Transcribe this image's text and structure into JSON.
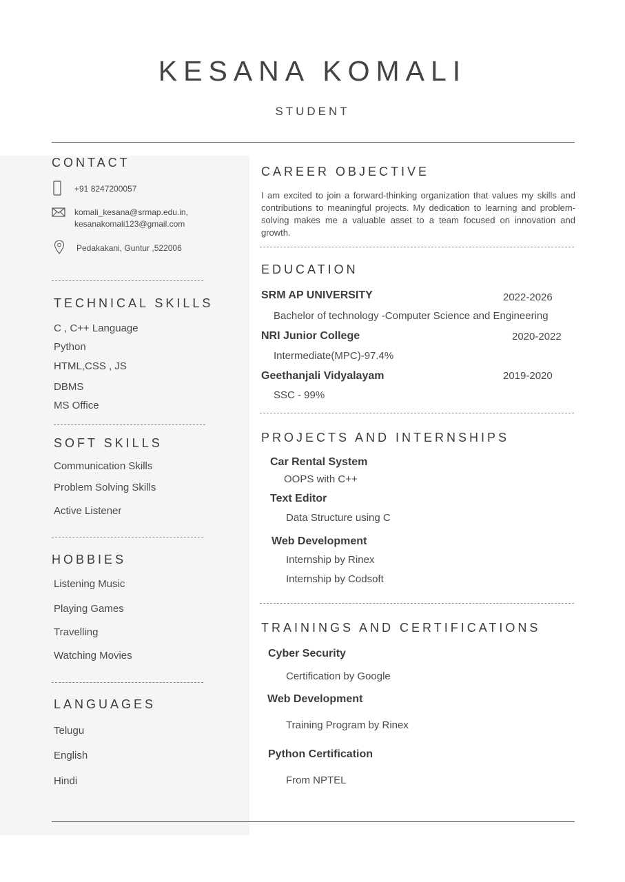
{
  "header": {
    "name": "KESANA KOMALI",
    "title": "STUDENT"
  },
  "contact": {
    "heading": "CONTACT",
    "phone": "+91 8247200057",
    "email1": "komali_kesana@srmap.edu.in,",
    "email2": "kesanakomali123@gmail.com",
    "address": "Pedakakani, Guntur ,522006"
  },
  "technical_skills": {
    "heading": "TECHNICAL SKILLS",
    "items": [
      "C , C++ Language",
      "Python",
      "HTML,CSS , JS",
      "DBMS",
      "MS Office"
    ]
  },
  "soft_skills": {
    "heading": "SOFT SKILLS",
    "items": [
      "Communication Skills",
      "Problem Solving Skills",
      "Active Listener"
    ]
  },
  "hobbies": {
    "heading": "HOBBIES",
    "items": [
      "Listening Music",
      "Playing Games",
      "Travelling",
      "Watching Movies"
    ]
  },
  "languages": {
    "heading": "LANGUAGES",
    "items": [
      "Telugu",
      "English",
      "Hindi"
    ]
  },
  "career_objective": {
    "heading": "CAREER OBJECTIVE",
    "text": "I am excited to join a forward-thinking organization that values my skills and contributions to meaningful projects. My dedication to learning and problem-solving makes me a valuable asset to a team focused on innovation and growth."
  },
  "education": {
    "heading": "EDUCATION",
    "entries": [
      {
        "school": "SRM AP UNIVERSITY",
        "years": "2022-2026",
        "detail": "Bachelor of technology -Computer Science and Engineering"
      },
      {
        "school": "NRI Junior College",
        "years": "2020-2022",
        "detail": "Intermediate(MPC)-97.4%"
      },
      {
        "school": "Geethanjali Vidyalayam",
        "years": "2019-2020",
        "detail": "SSC - 99%"
      }
    ]
  },
  "projects": {
    "heading": "PROJECTS AND INTERNSHIPS",
    "entries": [
      {
        "title": "Car Rental System",
        "details": [
          "OOPS with C++"
        ]
      },
      {
        "title": "Text Editor",
        "details": [
          "Data Structure using C"
        ]
      },
      {
        "title": "Web Development",
        "details": [
          "Internship by Rinex",
          "Internship by Codsoft"
        ]
      }
    ]
  },
  "trainings": {
    "heading": "TRAININGS AND CERTIFICATIONS",
    "entries": [
      {
        "title": "Cyber Security",
        "detail": "Certification by Google"
      },
      {
        "title": "Web Development",
        "detail": "Training Program by Rinex"
      },
      {
        "title": "Python Certification",
        "detail": "From NPTEL"
      }
    ]
  },
  "icons": {
    "phone": "phone-icon",
    "email": "envelope-icon",
    "location": "location-pin-icon"
  },
  "colors": {
    "text": "#4a4a4a",
    "sidebar_bg": "#f5f5f5",
    "rule": "#666666"
  }
}
